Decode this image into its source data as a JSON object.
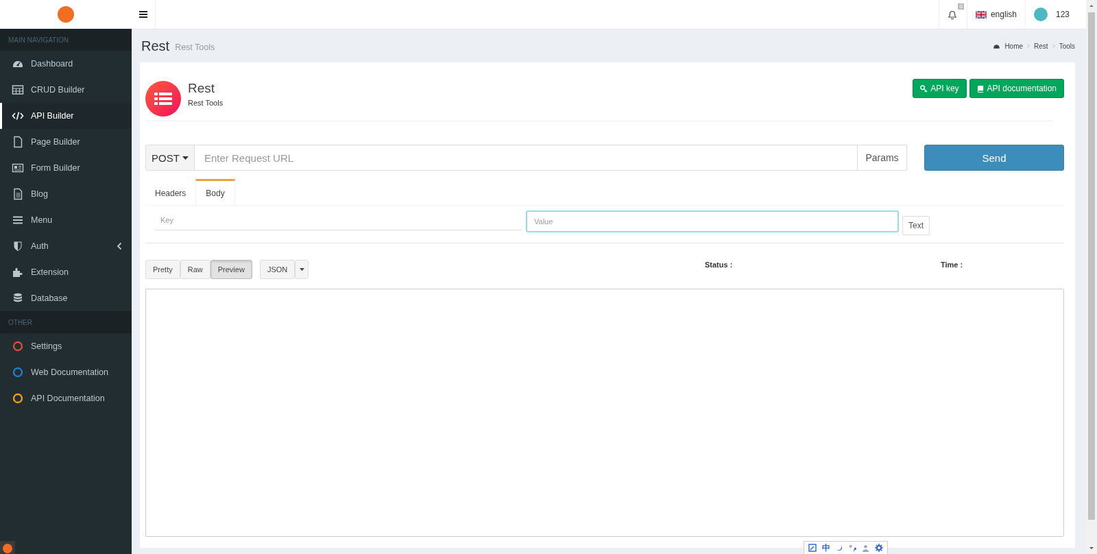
{
  "sidebar": {
    "sections": [
      {
        "header": "MAIN NAVIGATION",
        "items": [
          {
            "label": "Dashboard",
            "kind": "gauge",
            "selected": false,
            "submenu": false
          },
          {
            "label": "CRUD Builder",
            "kind": "table",
            "selected": false,
            "submenu": false
          },
          {
            "label": "API Builder",
            "kind": "code",
            "selected": true,
            "submenu": false
          },
          {
            "label": "Page Builder",
            "kind": "file",
            "selected": false,
            "submenu": false
          },
          {
            "label": "Form Builder",
            "kind": "newspaper",
            "selected": false,
            "submenu": false
          },
          {
            "label": "Blog",
            "kind": "document",
            "selected": false,
            "submenu": false
          },
          {
            "label": "Menu",
            "kind": "bars",
            "selected": false,
            "submenu": false
          },
          {
            "label": "Auth",
            "kind": "shield",
            "selected": false,
            "submenu": true
          },
          {
            "label": "Extension",
            "kind": "puzzle",
            "selected": false,
            "submenu": false
          },
          {
            "label": "Database",
            "kind": "database",
            "selected": false,
            "submenu": false
          }
        ]
      },
      {
        "header": "OTHER",
        "items": [
          {
            "label": "Settings",
            "kind": "circle",
            "color": "#dd4b39",
            "selected": false,
            "submenu": false
          },
          {
            "label": "Web Documentation",
            "kind": "circle",
            "color": "#1f7fc4",
            "selected": false,
            "submenu": false
          },
          {
            "label": "API Documentation",
            "kind": "circle",
            "color": "#f39c12",
            "selected": false,
            "submenu": false
          }
        ]
      }
    ]
  },
  "topbar": {
    "notifications": "0",
    "language": "english",
    "user": "123"
  },
  "page_header": {
    "title": "Rest",
    "subtitle": "Rest Tools",
    "breadcrumb": [
      "Home",
      "Rest",
      "Tools"
    ]
  },
  "card": {
    "title": "Rest",
    "subtitle": "Rest Tools",
    "buttons": [
      {
        "label": "API key",
        "kind": "key"
      },
      {
        "label": "API documentation",
        "kind": "book"
      }
    ]
  },
  "request": {
    "method": "POST",
    "url_placeholder": "Enter Request URL",
    "params": "Params",
    "send": "Send"
  },
  "tabs": [
    {
      "label": "Headers",
      "selected": false
    },
    {
      "label": "Body",
      "selected": true
    }
  ],
  "body_row": {
    "key_placeholder": "Key",
    "value_placeholder": "Value",
    "value_focused": true,
    "type": "Text"
  },
  "view_buttons": [
    {
      "label": "Pretty",
      "selected": false
    },
    {
      "label": "Raw",
      "selected": false
    },
    {
      "label": "Preview",
      "selected": true
    }
  ],
  "format": "JSON",
  "status_label": "Status :",
  "time_label": "Time :",
  "ime_toolbar": {
    "mode": "中"
  }
}
